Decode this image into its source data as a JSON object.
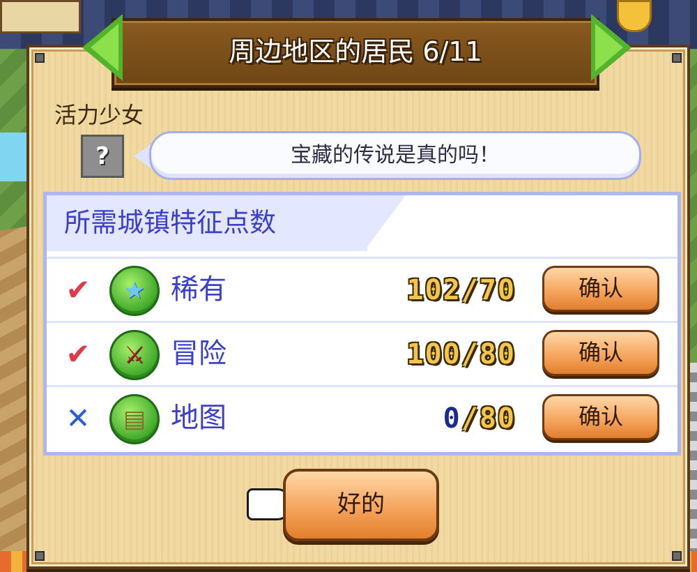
{
  "title": "周边地区的居民 6/11",
  "resident": {
    "name": "活力少女",
    "portrait_glyph": "?",
    "speech": "宝藏的传说是真的吗！"
  },
  "requirements": {
    "header": "所需城镇特征点数",
    "items": [
      {
        "name": "稀有",
        "icon": "star-icon",
        "icon_glyph": "★",
        "status": "met",
        "mark": "✔",
        "value": "102/70",
        "confirm_label": "确认"
      },
      {
        "name": "冒险",
        "icon": "sword-icon",
        "icon_glyph": "⚔",
        "status": "met",
        "mark": "✔",
        "value": "100/80",
        "confirm_label": "确认"
      },
      {
        "name": "地图",
        "icon": "map-scroll-icon",
        "icon_glyph": "▤",
        "status": "unmet",
        "mark": "✕",
        "have": "0",
        "need": "/80",
        "confirm_label": "确认"
      }
    ]
  },
  "ok_button": "好的",
  "colors": {
    "panel": "#f1d9a0",
    "accent_blue": "#3b3fc9",
    "check_red": "#e1384a",
    "cross_blue": "#2a5fd8",
    "button_orange": "#f4a259",
    "arrow_green": "#53b42c"
  }
}
